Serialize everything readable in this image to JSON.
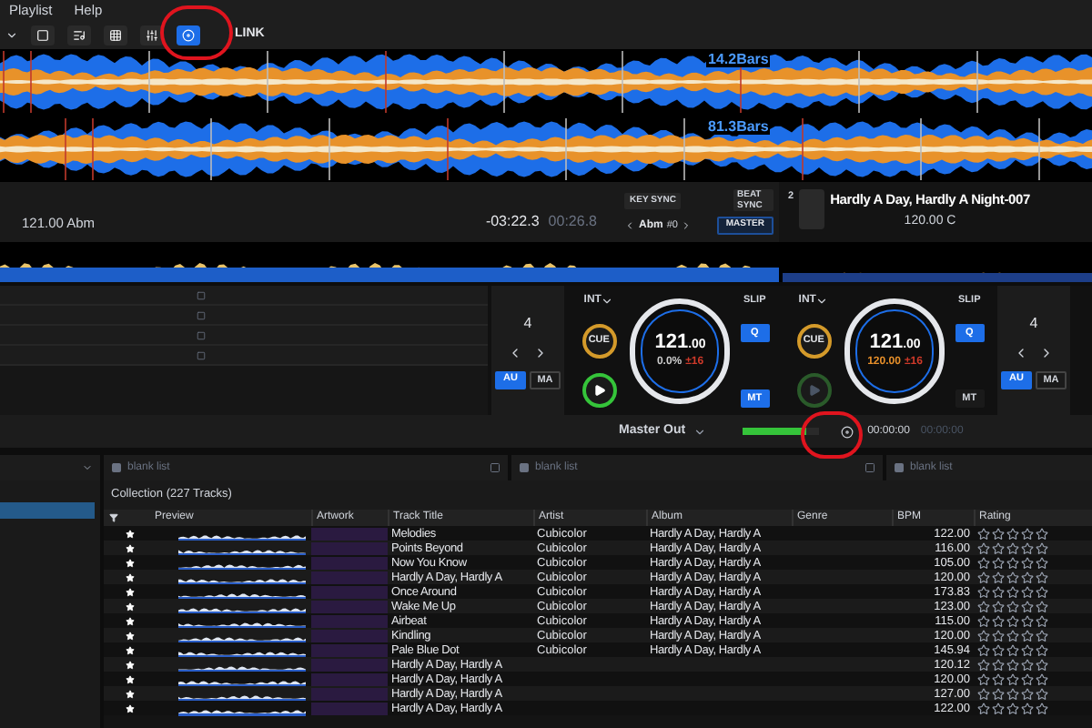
{
  "menu": [
    "Playlist",
    "Help"
  ],
  "toolbar": {
    "tools": [
      {
        "selected": false
      },
      {
        "selected": false
      },
      {
        "selected": false
      },
      {
        "selected": false
      },
      {
        "selected": true
      }
    ],
    "link": "LINK"
  },
  "waveforms": [
    {
      "bars": "14.2Bars"
    },
    {
      "bars": "81.3Bars"
    }
  ],
  "deck_1": {
    "bpm_key": "121.00 Abm",
    "remaining": "-03:22.3",
    "elapsed": "00:26.8"
  },
  "sync": {
    "key_sync": "KEY SYNC",
    "beat_sync": "BEAT SYNC",
    "key": "Abm",
    "key_offset": "#0",
    "master": "MASTER"
  },
  "deck_2": {
    "number": "2",
    "title": "Hardly A Day, Hardly A Night-007",
    "bpm_key": "120.00 C"
  },
  "players": [
    {
      "int": "INT",
      "cue": "CUE",
      "bpm": "121",
      "bpm_decimal": ".00",
      "pitch": {
        "text": "0.0%",
        "color": "#cccccc"
      },
      "range": "±16",
      "slip_label": "SLIP",
      "slip": false,
      "q_label": "Q",
      "quantize": true,
      "mt_label": "MT",
      "master_tempo": true,
      "playing": true
    },
    {
      "int": "INT",
      "cue": "CUE",
      "bpm": "121",
      "bpm_decimal": ".00",
      "pitch": {
        "text": "120.00",
        "color": "#e8902a"
      },
      "range": "±16",
      "slip_label": "SLIP",
      "slip": false,
      "q_label": "Q",
      "quantize": true,
      "mt_label": "MT",
      "master_tempo": false,
      "playing": false
    }
  ],
  "beat_loops": [
    {
      "value": "4",
      "au": "AU",
      "au_on": true,
      "ma": "MA",
      "ma_on": false
    },
    {
      "value": "4",
      "au": "AU",
      "au_on": true,
      "ma": "MA",
      "ma_on": false
    }
  ],
  "mixer": {
    "output": "Master Out",
    "level": 0.85,
    "time": "00:00:00",
    "time_2": "00:00:00"
  },
  "tabs": [
    {
      "label": "blank list"
    },
    {
      "label": "blank list"
    },
    {
      "label": "blank list"
    }
  ],
  "sidebar": {
    "items": [
      {
        "selected": true
      }
    ]
  },
  "collection": {
    "title": "Collection (227 Tracks)",
    "columns": [
      "Preview",
      "Artwork",
      "Track Title",
      "Artist",
      "Album",
      "Genre",
      "BPM",
      "Rating"
    ],
    "rows": [
      {
        "title": "Melodies",
        "artist": "Cubicolor",
        "album": "Hardly A Day, Hardly A",
        "bpm": "122.00",
        "stars": 0
      },
      {
        "title": "Points Beyond",
        "artist": "Cubicolor",
        "album": "Hardly A Day, Hardly A",
        "bpm": "116.00",
        "stars": 0
      },
      {
        "title": "Now You Know",
        "artist": "Cubicolor",
        "album": "Hardly A Day, Hardly A",
        "bpm": "105.00",
        "stars": 0
      },
      {
        "title": "Hardly A Day, Hardly A",
        "artist": "Cubicolor",
        "album": "Hardly A Day, Hardly A",
        "bpm": "120.00",
        "stars": 0
      },
      {
        "title": "Once Around",
        "artist": "Cubicolor",
        "album": "Hardly A Day, Hardly A",
        "bpm": "173.83",
        "stars": 0
      },
      {
        "title": "Wake Me Up",
        "artist": "Cubicolor",
        "album": "Hardly A Day, Hardly A",
        "bpm": "123.00",
        "stars": 0
      },
      {
        "title": "Airbeat",
        "artist": "Cubicolor",
        "album": "Hardly A Day, Hardly A",
        "bpm": "115.00",
        "stars": 0
      },
      {
        "title": "Kindling",
        "artist": "Cubicolor",
        "album": "Hardly A Day, Hardly A",
        "bpm": "120.00",
        "stars": 0
      },
      {
        "title": "Pale Blue Dot",
        "artist": "Cubicolor",
        "album": "Hardly A Day, Hardly A",
        "bpm": "145.94",
        "stars": 0
      },
      {
        "title": "Hardly A Day, Hardly A",
        "bpm": "120.12",
        "stars": 0
      },
      {
        "title": "Hardly A Day, Hardly A",
        "bpm": "120.00",
        "stars": 0
      },
      {
        "title": "Hardly A Day, Hardly A",
        "bpm": "127.00",
        "stars": 0
      },
      {
        "title": "Hardly A Day, Hardly A",
        "bpm": "122.00",
        "stars": 0
      }
    ]
  }
}
